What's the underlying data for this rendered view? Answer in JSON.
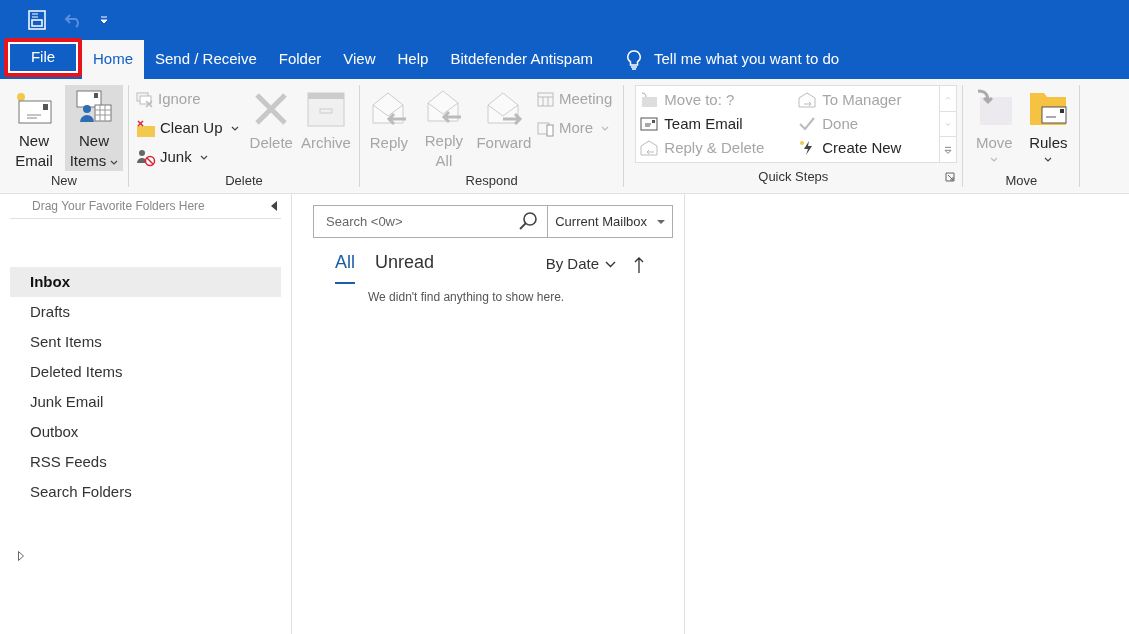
{
  "tabs": [
    {
      "label": "File",
      "selected": false,
      "highlighted": true
    },
    {
      "label": "Home",
      "selected": true,
      "highlighted": false
    },
    {
      "label": "Send / Receive",
      "selected": false,
      "highlighted": false
    },
    {
      "label": "Folder",
      "selected": false,
      "highlighted": false
    },
    {
      "label": "View",
      "selected": false,
      "highlighted": false
    },
    {
      "label": "Help",
      "selected": false,
      "highlighted": false
    },
    {
      "label": "Bitdefender Antispam",
      "selected": false,
      "highlighted": false
    }
  ],
  "tell_me": "Tell me what you want to do",
  "ribbon": {
    "groups": [
      {
        "label": "New",
        "buttons": [
          {
            "kind": "large",
            "label": "New Email",
            "disabled": false,
            "dropdown": false,
            "pressed": false
          },
          {
            "kind": "large",
            "label": "New Items",
            "disabled": false,
            "dropdown": true,
            "pressed": true
          }
        ]
      },
      {
        "label": "Delete",
        "buttons": [
          {
            "kind": "small",
            "label": "Ignore",
            "disabled": true,
            "dropdown": false,
            "pressed": false
          },
          {
            "kind": "small",
            "label": "Clean Up",
            "disabled": false,
            "dropdown": true,
            "pressed": false
          },
          {
            "kind": "small",
            "label": "Junk",
            "disabled": false,
            "dropdown": true,
            "pressed": false
          },
          {
            "kind": "large",
            "label": "Delete",
            "disabled": true,
            "dropdown": false,
            "pressed": false
          },
          {
            "kind": "large",
            "label": "Archive",
            "disabled": true,
            "dropdown": false,
            "pressed": false
          }
        ]
      },
      {
        "label": "Respond",
        "buttons": [
          {
            "kind": "large",
            "label": "Reply",
            "disabled": true,
            "dropdown": false,
            "pressed": false
          },
          {
            "kind": "large",
            "label": "Reply All",
            "disabled": true,
            "dropdown": false,
            "pressed": false
          },
          {
            "kind": "large",
            "label": "Forward",
            "disabled": true,
            "dropdown": false,
            "pressed": false
          },
          {
            "kind": "small",
            "label": "Meeting",
            "disabled": true,
            "dropdown": false,
            "pressed": false
          },
          {
            "kind": "small",
            "label": "More",
            "disabled": true,
            "dropdown": true,
            "pressed": false
          }
        ]
      },
      {
        "label": "Quick Steps",
        "quick_steps": [
          {
            "label": "Move to: ?",
            "disabled": true
          },
          {
            "label": "Team Email",
            "disabled": false
          },
          {
            "label": "Reply & Delete",
            "disabled": true
          },
          {
            "label": "To Manager",
            "disabled": true
          },
          {
            "label": "Done",
            "disabled": true
          },
          {
            "label": "Create New",
            "disabled": false
          }
        ]
      },
      {
        "label": "Move",
        "buttons": [
          {
            "kind": "tall",
            "label": "Move",
            "disabled": true,
            "dropdown": true,
            "pressed": false
          },
          {
            "kind": "tall",
            "label": "Rules",
            "disabled": false,
            "dropdown": true,
            "pressed": false
          }
        ]
      }
    ]
  },
  "sidebar": {
    "favorites_hint": "Drag Your Favorite Folders Here",
    "folders": [
      {
        "label": "Inbox",
        "selected": true
      },
      {
        "label": "Drafts",
        "selected": false
      },
      {
        "label": "Sent Items",
        "selected": false
      },
      {
        "label": "Deleted Items",
        "selected": false
      },
      {
        "label": "Junk Email",
        "selected": false
      },
      {
        "label": "Outbox",
        "selected": false
      },
      {
        "label": "RSS Feeds",
        "selected": false
      },
      {
        "label": "Search Folders",
        "selected": false
      }
    ]
  },
  "mail_list": {
    "search": {
      "placeholder": "Search <0w>"
    },
    "scope": "Current Mailbox",
    "filters": [
      {
        "label": "All",
        "selected": true
      },
      {
        "label": "Unread",
        "selected": false
      }
    ],
    "sort": "By Date",
    "empty_message": "We didn't find anything to show here."
  }
}
